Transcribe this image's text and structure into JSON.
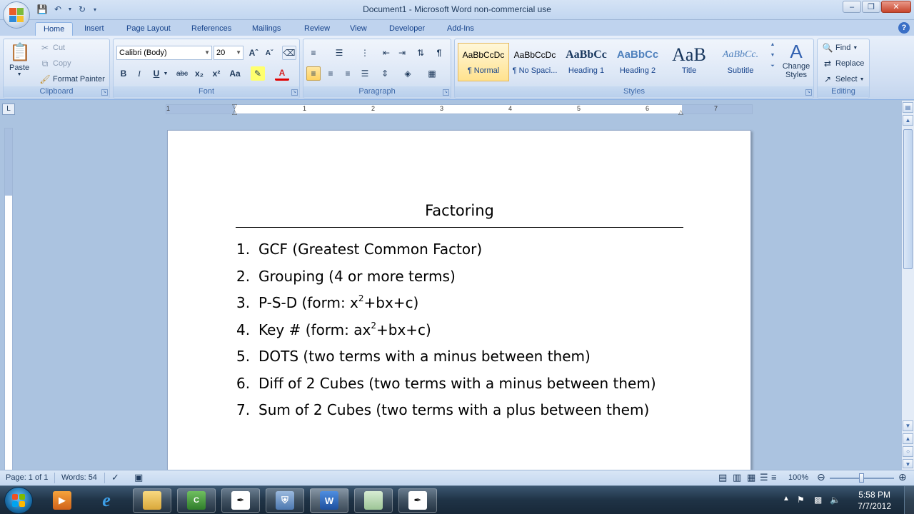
{
  "window": {
    "title": "Document1 - Microsoft Word non-commercial use"
  },
  "tabs": [
    "Home",
    "Insert",
    "Page Layout",
    "References",
    "Mailings",
    "Review",
    "View",
    "Developer",
    "Add-Ins"
  ],
  "active_tab": "Home",
  "clipboard": {
    "paste": "Paste",
    "cut": "Cut",
    "copy": "Copy",
    "format_painter": "Format Painter",
    "label": "Clipboard"
  },
  "font": {
    "name": "Calibri (Body)",
    "size": "20",
    "label": "Font"
  },
  "paragraph": {
    "label": "Paragraph"
  },
  "styles": {
    "items": [
      {
        "sample": "AaBbCcDc",
        "name": "¶ Normal"
      },
      {
        "sample": "AaBbCcDc",
        "name": "¶ No Spaci..."
      },
      {
        "sample": "AaBbCc",
        "name": "Heading 1"
      },
      {
        "sample": "AaBbCc",
        "name": "Heading 2"
      },
      {
        "sample": "AaB",
        "name": "Title"
      },
      {
        "sample": "AaBbCc.",
        "name": "Subtitle"
      }
    ],
    "change_styles": "Change Styles",
    "label": "Styles"
  },
  "editing": {
    "find": "Find",
    "replace": "Replace",
    "select": "Select",
    "label": "Editing"
  },
  "ruler": {
    "numbers": [
      "1",
      "1",
      "2",
      "3",
      "4",
      "5",
      "6",
      "7"
    ]
  },
  "document": {
    "title": "Factoring",
    "items": [
      {
        "num": "1.",
        "text": "GCF (Greatest Common Factor)"
      },
      {
        "num": "2.",
        "text": "Grouping (4 or more terms)"
      },
      {
        "num": "3.",
        "pre": "P-S-D (form: x",
        "sup": "2",
        "post": "+bx+c)"
      },
      {
        "num": "4.",
        "pre": "Key # (form: ax",
        "sup": "2",
        "post": "+bx+c)"
      },
      {
        "num": "5.",
        "text": "DOTS (two terms with a minus between them)"
      },
      {
        "num": "6.",
        "text": "Diff of 2 Cubes (two terms with a minus between them)"
      },
      {
        "num": "7.",
        "text": "Sum of 2 Cubes (two terms with a plus between them)"
      }
    ]
  },
  "status": {
    "page": "Page: 1 of 1",
    "words": "Words: 54",
    "zoom": "100%"
  },
  "taskbar": {
    "time": "5:58 PM",
    "date": "7/7/2012"
  }
}
